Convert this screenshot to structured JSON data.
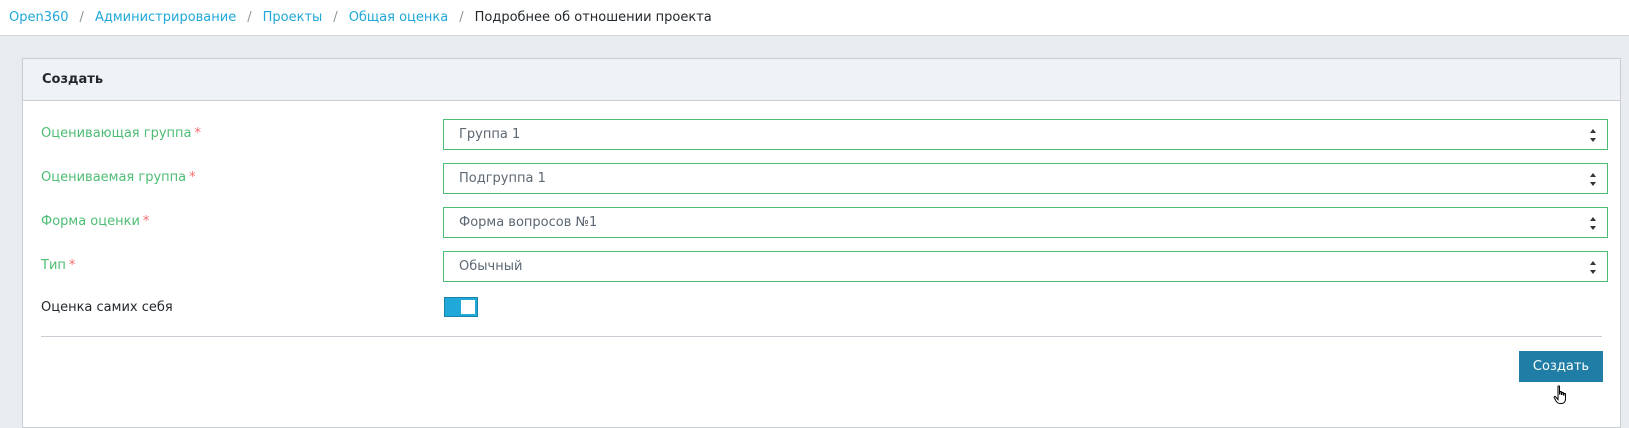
{
  "breadcrumb": {
    "items": [
      {
        "label": "Open360"
      },
      {
        "label": "Администрирование"
      },
      {
        "label": "Проекты"
      },
      {
        "label": "Общая оценка"
      }
    ],
    "current": "Подробнее об отношении проекта",
    "separator": "/"
  },
  "card": {
    "title": "Создать",
    "fields": [
      {
        "label": "Оценивающая группа",
        "required_mark": "*",
        "value": "Группа 1"
      },
      {
        "label": "Оцениваемая группа",
        "required_mark": "*",
        "value": "Подгруппа 1"
      },
      {
        "label": "Форма оценки",
        "required_mark": "*",
        "value": "Форма вопросов №1"
      },
      {
        "label": "Тип",
        "required_mark": "*",
        "value": "Обычный"
      }
    ],
    "toggle": {
      "label": "Оценка самих себя",
      "checked": true
    },
    "submit_label": "Создать"
  },
  "colors": {
    "link": "#20a8d8",
    "valid_green": "#4dbd74",
    "required_red": "#f86c6b",
    "toggle_on": "#20a8d8",
    "primary_button": "#1f7da6"
  },
  "icons": {
    "select_arrows": "sort-arrows-icon",
    "cursor": "hand-pointer-icon"
  }
}
